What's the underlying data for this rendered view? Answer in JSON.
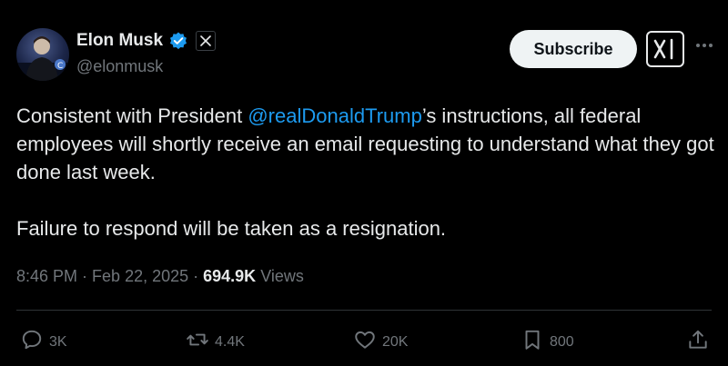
{
  "author": {
    "name": "Elon Musk",
    "handle": "@elonmusk"
  },
  "header": {
    "subscribe_label": "Subscribe"
  },
  "tweet": {
    "text_before_mention": "Consistent with President ",
    "mention": "@realDonaldTrump",
    "text_after_mention": "’s instructions, all federal employees will shortly receive an email requesting to understand what they got done last week.",
    "paragraph2": "Failure to respond will be taken as a resignation.",
    "time": "8:46 PM",
    "date": "Feb 22, 2025",
    "views_count": "694.9K",
    "views_label": "Views"
  },
  "actions": {
    "replies": "3K",
    "reposts": "4.4K",
    "likes": "20K",
    "bookmarks": "800"
  },
  "colors": {
    "background": "#000000",
    "text": "#e7e9ea",
    "muted": "#71767b",
    "link": "#1d9bf0",
    "verified": "#1d9bf0"
  },
  "icons": [
    "verified-badge-icon",
    "x-logo-icon",
    "xai-logo-icon",
    "more-icon",
    "reply-icon",
    "repost-icon",
    "like-icon",
    "bookmark-icon",
    "share-icon"
  ]
}
